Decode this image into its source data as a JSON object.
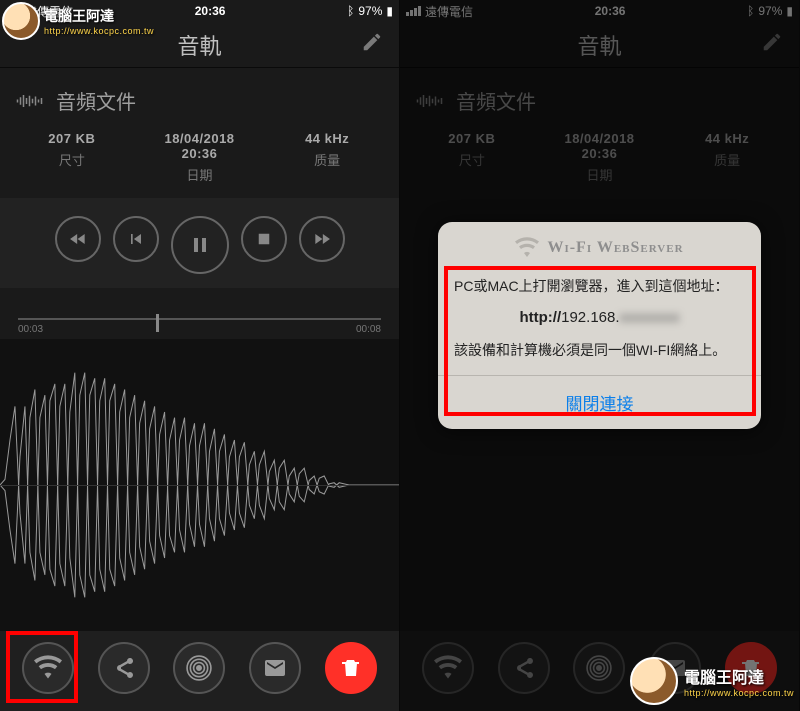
{
  "status": {
    "carrier": "遠傳電信",
    "time": "20:36",
    "battery": "97%"
  },
  "nav": {
    "title": "音軌",
    "edit_icon": "pencil-icon"
  },
  "file": {
    "title": "音頻文件"
  },
  "info": {
    "size_val": "207 KB",
    "size_lbl": "尺寸",
    "date_val": "18/04/2018",
    "time_val": "20:36",
    "date_lbl": "日期",
    "quality_val": "44 kHz",
    "quality_lbl": "质量"
  },
  "progress": {
    "current": "00:03",
    "total": "00:08",
    "position_pct": 38
  },
  "dialog": {
    "title": "Wi-Fi WebServer",
    "line1": "PC或MAC上打開瀏覽器，進入到這個地址：",
    "url_prefix": "http://",
    "url_ip": "192.168.",
    "line2": "該設備和計算機必須是同一個WI-FI網絡上。",
    "close": "關閉連接"
  },
  "watermark": {
    "name": "電腦王阿達",
    "url": "http://www.kocpc.com.tw"
  },
  "colors": {
    "accent_red": "#ff3028",
    "highlight_box": "#ff0000",
    "link": "#0b7fea"
  }
}
